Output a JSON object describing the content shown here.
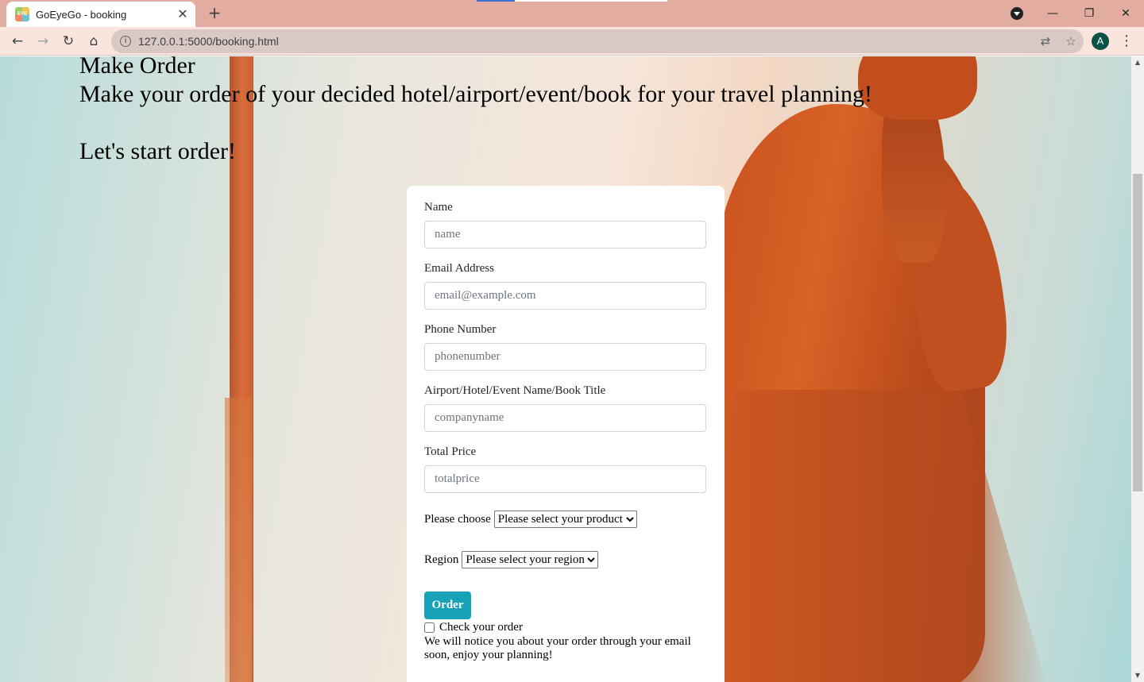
{
  "browser": {
    "tab_title": "GoEyeGo - booking",
    "favicon_text": "EYE",
    "url": "127.0.0.1:5000/booking.html",
    "avatar_letter": "A",
    "colors": {
      "tabbar": "#e2ada0",
      "toolbar": "#fae5de",
      "avatar": "#0b5145"
    }
  },
  "intro": {
    "title": "Make Order",
    "subtitle": "Make your order of your decided hotel/airport/event/book for your travel planning!",
    "cta": "Let's start order!"
  },
  "form": {
    "name_label": "Name",
    "name_placeholder": "name",
    "email_label": "Email Address",
    "email_placeholder": "email@example.com",
    "phone_label": "Phone Number",
    "phone_placeholder": "phonenumber",
    "company_label": "Airport/Hotel/Event Name/Book Title",
    "company_placeholder": "companyname",
    "price_label": "Total Price",
    "price_placeholder": "totalprice",
    "product_label": "Please choose",
    "product_selected": "Please select your product",
    "region_label": "Region",
    "region_selected": "Please select your region",
    "order_button": "Order",
    "check_label": "Check your order",
    "check_checked": false,
    "notice": "We will notice you about your order through your email soon, enjoy your planning!",
    "accent_color": "#17a2b8"
  }
}
